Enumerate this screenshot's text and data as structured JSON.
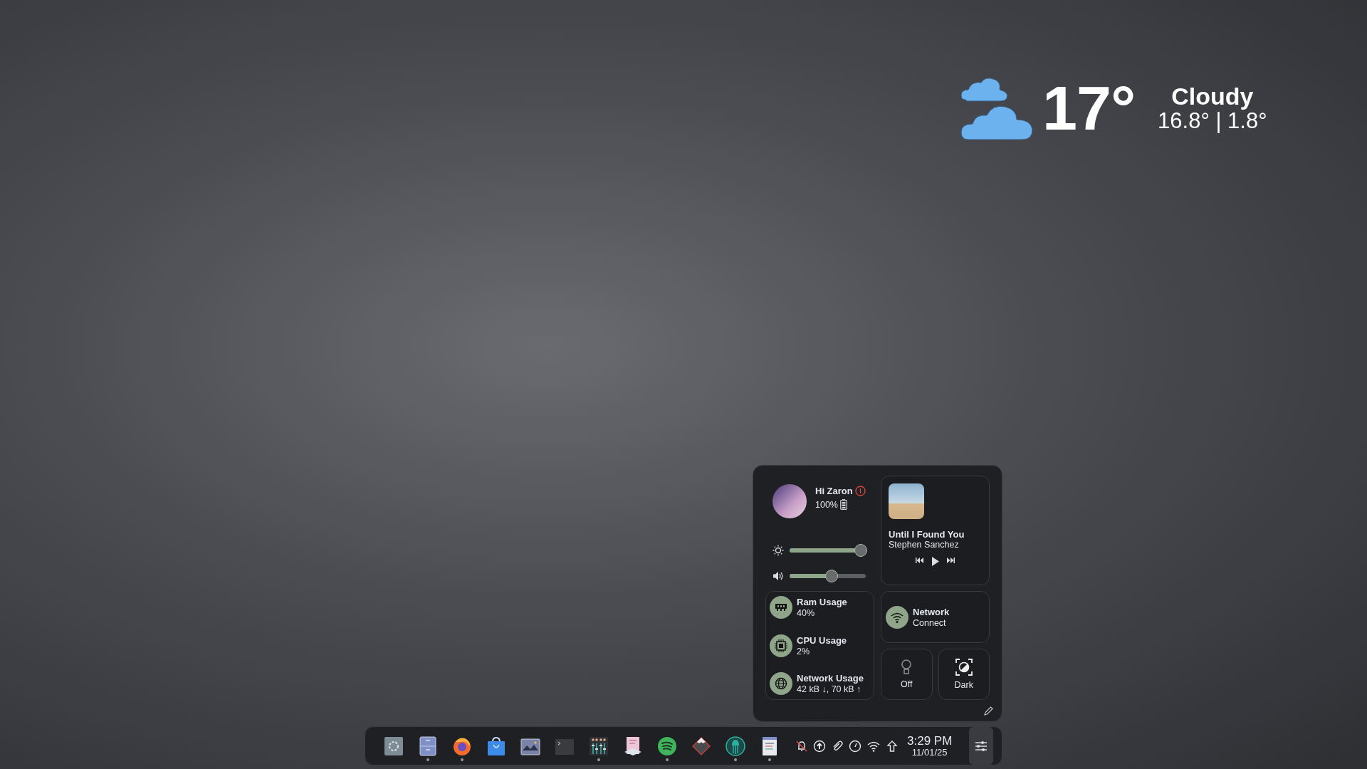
{
  "weather": {
    "temperature": "17°",
    "condition": "Cloudy",
    "range": "16.8° | 1.8°"
  },
  "panel": {
    "greeting": "Hi Zaron",
    "battery": "100%",
    "sliders": [
      {
        "kind": "brightness",
        "level": 0.93
      },
      {
        "kind": "volume",
        "level": 0.55
      }
    ],
    "media": {
      "title": "Until I Found You",
      "artist": "Stephen Sanchez"
    },
    "stats": [
      {
        "kind": "ram",
        "label": "Ram Usage",
        "value": "40%"
      },
      {
        "kind": "cpu",
        "label": "CPU Usage",
        "value": "2%"
      },
      {
        "kind": "network",
        "label": "Network Usage",
        "value": "42 kB ↓, 70 kB ↑"
      }
    ],
    "network": {
      "title": "Network",
      "status": "Connect"
    },
    "toggles": [
      {
        "kind": "light",
        "label": "Off"
      },
      {
        "kind": "theme",
        "label": "Dark"
      }
    ]
  },
  "taskbar": {
    "apps": [
      {
        "kind": "launcher",
        "running": false
      },
      {
        "kind": "files",
        "running": true
      },
      {
        "kind": "browser",
        "running": true
      },
      {
        "kind": "store",
        "running": false
      },
      {
        "kind": "images",
        "running": false
      },
      {
        "kind": "terminal",
        "running": false
      },
      {
        "kind": "mixer",
        "running": true
      },
      {
        "kind": "document",
        "running": false
      },
      {
        "kind": "music",
        "running": true
      },
      {
        "kind": "diamond",
        "running": false
      },
      {
        "kind": "git",
        "running": true
      },
      {
        "kind": "notes",
        "running": true
      }
    ],
    "tray": [
      {
        "kind": "bell-off"
      },
      {
        "kind": "upload"
      },
      {
        "kind": "clip"
      },
      {
        "kind": "gauge"
      },
      {
        "kind": "wifi"
      },
      {
        "kind": "arrow-up"
      }
    ],
    "clock": {
      "time": "3:29 PM",
      "date": "11/01/25"
    },
    "settings_button": {
      "selected": true
    }
  }
}
